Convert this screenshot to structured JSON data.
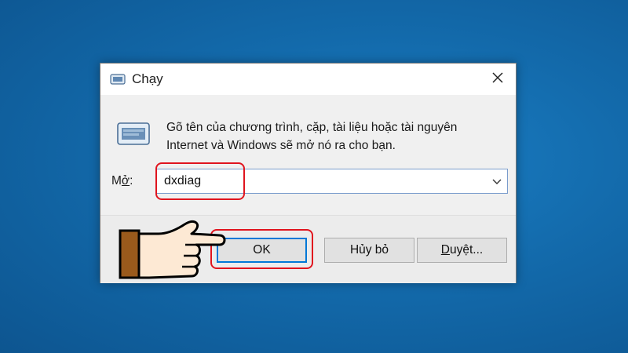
{
  "dialog": {
    "title": "Chạy",
    "description_line1": "Gõ tên của chương trình, cặp, tài liệu hoặc tài nguyên",
    "description_line2": "Internet và Windows sẽ mở nó ra cho bạn.",
    "open_label_prefix": "M",
    "open_label_underlined": "ở",
    "open_label_suffix": ":",
    "open_value": "dxdiag",
    "buttons": {
      "ok": "OK",
      "cancel": "Hủy bỏ",
      "browse_underlined": "D",
      "browse_rest": "uyệt..."
    }
  },
  "icons": {
    "title": "run-icon",
    "big": "run-icon",
    "close": "close-icon",
    "dropdown": "chevron-down-icon",
    "hand": "pointing-hand-icon"
  },
  "colors": {
    "desktop": "#136aab",
    "highlight": "#e0141e",
    "ok_focus": "#0078d7"
  }
}
